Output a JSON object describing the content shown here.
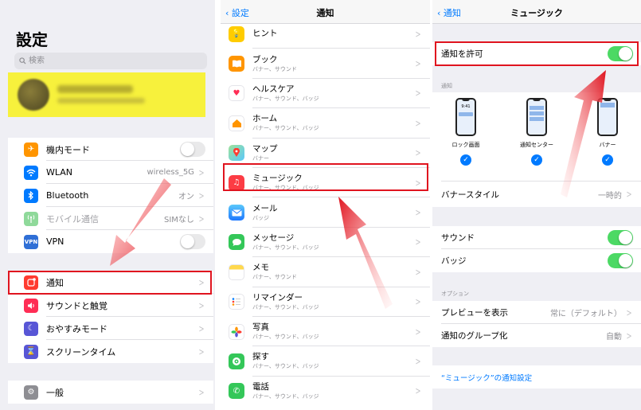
{
  "settings": {
    "title": "設定",
    "search_placeholder": "検索",
    "profile": {
      "name": "Yanyan Yan",
      "subtitle": "Apple ID、iCloud、iTunes Store"
    },
    "group1": [
      {
        "label": "機内モード",
        "icon": "airplane-icon",
        "color": "#ff9500",
        "kind": "toggle",
        "on": false
      },
      {
        "label": "WLAN",
        "icon": "wifi-icon",
        "color": "#007aff",
        "kind": "value",
        "value": "wireless_5G"
      },
      {
        "label": "Bluetooth",
        "icon": "bluetooth-icon",
        "color": "#007aff",
        "kind": "value",
        "value": "オン"
      },
      {
        "label": "モバイル通信",
        "icon": "antenna-icon",
        "color": "#8fd99a",
        "kind": "value",
        "value": "SIMなし",
        "dimmed": true
      },
      {
        "label": "VPN",
        "icon": "vpn-icon",
        "color": "#2f6fd6",
        "kind": "toggle",
        "on": false
      }
    ],
    "group2": [
      {
        "label": "通知",
        "icon": "notifications-icon",
        "color": "#ff3b30"
      },
      {
        "label": "サウンドと触覚",
        "icon": "speaker-icon",
        "color": "#ff2d55"
      },
      {
        "label": "おやすみモード",
        "icon": "moon-icon",
        "color": "#5856d6"
      },
      {
        "label": "スクリーンタイム",
        "icon": "hourglass-icon",
        "color": "#5856d6"
      }
    ],
    "group3": [
      {
        "label": "一般",
        "icon": "gear-icon",
        "color": "#8e8e93"
      }
    ]
  },
  "notifications": {
    "back_label": "設定",
    "title": "通知",
    "apps": [
      {
        "name": "ヒント",
        "detail": "",
        "icon": "lightbulb-icon",
        "color": "#ffcc00"
      },
      {
        "name": "ブック",
        "detail": "バナー、サウンド",
        "icon": "book-icon",
        "color": "#ff9500"
      },
      {
        "name": "ヘルスケア",
        "detail": "バナー、サウンド、バッジ",
        "icon": "heart-icon",
        "color": "#ffffff"
      },
      {
        "name": "ホーム",
        "detail": "バナー、サウンド、バッジ",
        "icon": "home-icon",
        "color": "#ffffff"
      },
      {
        "name": "マップ",
        "detail": "バナー",
        "icon": "map-icon",
        "color": "#5ac8fa"
      },
      {
        "name": "ミュージック",
        "detail": "バナー、サウンド、バッジ",
        "icon": "music-icon",
        "color": "#fc3c44"
      },
      {
        "name": "メール",
        "detail": "バッジ",
        "icon": "mail-icon",
        "color": "#1e90ff"
      },
      {
        "name": "メッセージ",
        "detail": "バナー、サウンド、バッジ",
        "icon": "message-icon",
        "color": "#34c759"
      },
      {
        "name": "メモ",
        "detail": "バナー、サウンド",
        "icon": "notes-icon",
        "color": "#ffd84d"
      },
      {
        "name": "リマインダー",
        "detail": "バナー、サウンド、バッジ",
        "icon": "reminders-icon",
        "color": "#ffffff"
      },
      {
        "name": "写真",
        "detail": "バナー、サウンド、バッジ",
        "icon": "photos-icon",
        "color": "#ffffff"
      },
      {
        "name": "探す",
        "detail": "バナー、サウンド、バッジ",
        "icon": "findmy-icon",
        "color": "#34c759"
      },
      {
        "name": "電話",
        "detail": "バナー、サウンド、バッジ",
        "icon": "phone-icon",
        "color": "#34c759"
      }
    ]
  },
  "music": {
    "back_label": "通知",
    "title": "ミュージック",
    "allow_label": "通知を許可",
    "allow_on": true,
    "alerts_header": "通知",
    "phone_time": "9:41",
    "styles": [
      {
        "label": "ロック画面",
        "checked": true
      },
      {
        "label": "通知センター",
        "checked": true
      },
      {
        "label": "バナー",
        "checked": true
      }
    ],
    "banner_style_label": "バナースタイル",
    "banner_style_value": "一時的",
    "sound_label": "サウンド",
    "sound_on": true,
    "badge_label": "バッジ",
    "badge_on": true,
    "options_header": "オプション",
    "preview_label": "プレビューを表示",
    "preview_value": "常に（デフォルト）",
    "grouping_label": "通知のグループ化",
    "grouping_value": "自動",
    "app_settings_link": "“ミュージック”の通知設定"
  },
  "colors": {
    "highlight": "#e0141f",
    "accent": "#007aff",
    "toggle_on": "#4cd964"
  }
}
